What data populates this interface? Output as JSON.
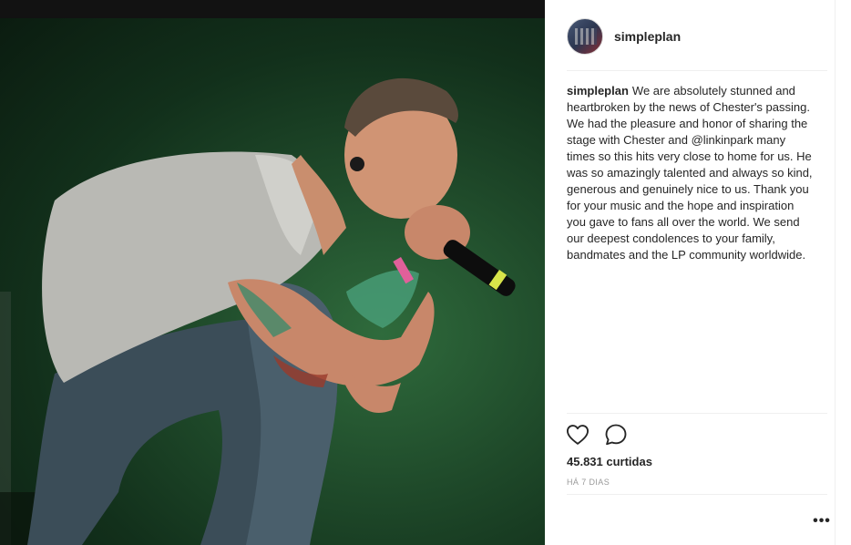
{
  "post": {
    "username": "simpleplan",
    "caption_username": "simpleplan",
    "caption_text": "We are absolutely stunned and heartbroken by the news of Chester's passing. We had the pleasure and honor of sharing the stage with Chester and @linkinpark many times so this hits very close to home for us. He was so amazingly talented and always so kind, generous and genuinely nice to us. Thank you for your music and the hope and inspiration you gave to fans all over the world. We send our deepest condolences to your family, bandmates and the LP community worldwide.",
    "likes": "45.831 curtidas",
    "timestamp": "HÁ 7 DIAS",
    "more_label": "•••"
  },
  "icons": {
    "like": "heart-icon",
    "comment": "comment-icon",
    "more": "more-options-icon"
  },
  "colors": {
    "text": "#262626",
    "muted": "#999999",
    "divider": "#efefef",
    "photo_background": "#1f4a2a"
  }
}
